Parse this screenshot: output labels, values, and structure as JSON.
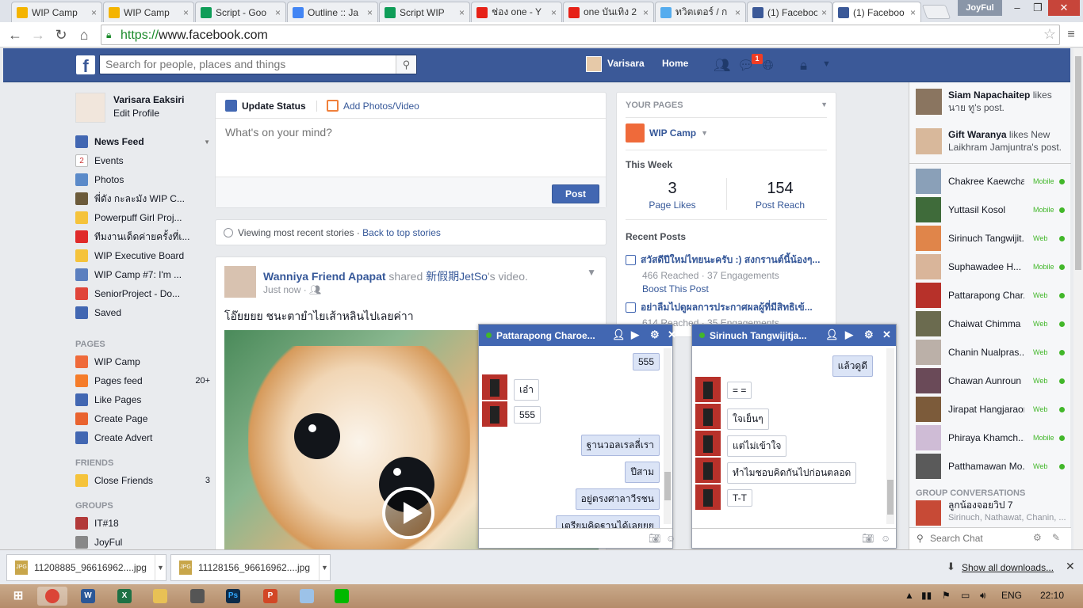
{
  "browser": {
    "tabs": [
      {
        "title": "WIP Camp",
        "icon": "drive-icon",
        "color": "#f4b400"
      },
      {
        "title": "WIP Camp",
        "icon": "drive-icon",
        "color": "#f4b400"
      },
      {
        "title": "Script - Goo",
        "icon": "sheets-icon",
        "color": "#0f9d58"
      },
      {
        "title": "Outline :: Ja",
        "icon": "docs-icon",
        "color": "#4285f4"
      },
      {
        "title": "Script WIP",
        "icon": "sheets-icon",
        "color": "#0f9d58"
      },
      {
        "title": "ช่อง one - Y",
        "icon": "youtube-icon",
        "color": "#e62117"
      },
      {
        "title": "one บันเทิง 2",
        "icon": "youtube-icon",
        "color": "#e62117"
      },
      {
        "title": "ทวิตเตอร์ / ก",
        "icon": "twitter-icon",
        "color": "#55acee"
      },
      {
        "title": "(1) Faceboo",
        "icon": "facebook-icon",
        "color": "#3b5998"
      },
      {
        "title": "(1) Faceboo",
        "icon": "facebook-icon",
        "color": "#3b5998"
      }
    ],
    "user": "JoyFul",
    "url_scheme": "https://",
    "url_host": "www.facebook.com"
  },
  "fb": {
    "logo": "f",
    "search_placeholder": "Search for people, places and things",
    "user_name": "Varisara",
    "home": "Home",
    "notif_count": "1"
  },
  "left": {
    "name": "Varisara Eaksiri",
    "edit": "Edit Profile",
    "favorites": [
      {
        "label": "News Feed",
        "bold": true,
        "icon": "news-feed-icon",
        "color": "#4267b2"
      },
      {
        "label": "Events",
        "icon": "calendar-icon",
        "color": "#ffffff",
        "badge": "2"
      },
      {
        "label": "Photos",
        "icon": "photos-icon",
        "color": "#5b8ac9"
      },
      {
        "label": "พี่ดัง กะละมัง WIP C...",
        "icon": "star-group-icon",
        "color": "#6b5a3a"
      },
      {
        "label": "Powerpuff Girl Proj...",
        "icon": "lightbulb-icon",
        "color": "#f5c33b"
      },
      {
        "label": "ทีมงานเด็ดค่ายครั้งที่เ...",
        "icon": "cup-icon",
        "color": "#e02a2a"
      },
      {
        "label": "WIP Executive Board",
        "icon": "lightbulb-icon",
        "color": "#f5c33b"
      },
      {
        "label": "WIP Camp #7: I'm ...",
        "icon": "shield-icon",
        "color": "#5b7fbf"
      },
      {
        "label": "SeniorProject - Do...",
        "icon": "gift-icon",
        "color": "#e0453a"
      },
      {
        "label": "Saved",
        "icon": "bookmark-icon",
        "color": "#4267b2"
      }
    ],
    "pages_title": "PAGES",
    "pages": [
      {
        "label": "WIP Camp",
        "icon": "wip-page-icon",
        "color": "#ef6a3a",
        "count": ""
      },
      {
        "label": "Pages feed",
        "icon": "flag-icon",
        "color": "#f57c2a",
        "count": "20+"
      },
      {
        "label": "Like Pages",
        "icon": "like-icon",
        "color": "#4267b2",
        "count": ""
      },
      {
        "label": "Create Page",
        "icon": "plus-icon",
        "color": "#e9632f",
        "count": ""
      },
      {
        "label": "Create Advert",
        "icon": "chart-icon",
        "color": "#4267b2",
        "count": ""
      }
    ],
    "friends_title": "FRIENDS",
    "friends": [
      {
        "label": "Close Friends",
        "icon": "star-icon",
        "color": "#f5c33b",
        "count": "3"
      }
    ],
    "groups_title": "GROUPS",
    "groups": [
      {
        "label": "IT#18",
        "icon": "glass-icon",
        "color": "#b23a3a"
      },
      {
        "label": "JoyFul",
        "icon": "skull-icon",
        "color": "#888888"
      }
    ]
  },
  "composer": {
    "update_status": "Update Status",
    "add_photos": "Add Photos/Video",
    "placeholder": "What's on your mind?",
    "post": "Post"
  },
  "recent": {
    "text": "Viewing most recent stories · ",
    "link": "Back to top stories"
  },
  "post": {
    "author": "Wanniya Friend Apapat",
    "action": " shared ",
    "source": "新假期JetSo",
    "suffix": "'s video.",
    "time": "Just now · ",
    "text": "โอ๊ยยยย ชนะตายำไยเส้าหลินไปเลยค่าา"
  },
  "pages_box": {
    "title": "YOUR PAGES",
    "page_name": "WIP Camp",
    "this_week": "This Week",
    "likes_value": "3",
    "likes_label": "Page Likes",
    "reach_value": "154",
    "reach_label": "Post Reach",
    "recent_title": "Recent Posts",
    "posts": [
      {
        "title": "สวัสดีปีใหม่ไทยนะครับ :) สงกรานต์นี้น้องๆ...",
        "meta": "466 Reached · 37 Engagements",
        "boost": "Boost This Post"
      },
      {
        "title": "อย่าลืมไปดูผลการประกาศผลผู้ที่มีสิทธิเข้...",
        "meta": "614 Reached · 35 Engagements"
      }
    ]
  },
  "chats": [
    {
      "name": "Pattarapong Charoe...",
      "messages": [
        {
          "text": "555",
          "me": true
        },
        {
          "text": "เอ๋า",
          "me": false
        },
        {
          "text": "555",
          "me": false
        },
        {
          "text": "ฐานวอลเรลลี่เรา",
          "me": true
        },
        {
          "text": "ปีสาม",
          "me": true
        },
        {
          "text": "อยู่ตรงศาลาวีรชน",
          "me": true
        },
        {
          "text": "เตรียมคิดฐานได้เลยยย",
          "me": true
        }
      ]
    },
    {
      "name": "Sirinuch Tangwijitja...",
      "messages": [
        {
          "text": "แล้วดูดี",
          "me": true
        },
        {
          "text": "= =",
          "me": false
        },
        {
          "text": "ใจเย็นๆ",
          "me": false
        },
        {
          "text": "แต่ไม่เข้าใจ",
          "me": false
        },
        {
          "text": "ทำไมชอบคิดกันไปก่อนตลอด",
          "me": false
        },
        {
          "text": "T-T",
          "me": false
        }
      ]
    }
  ],
  "ticker": [
    {
      "name": "Siam Napachaitep",
      "text": " likes นาย ทู's post."
    },
    {
      "name": "Gift Waranya",
      "text": " likes New Laikhram Jamjuntra's post."
    }
  ],
  "contacts": [
    {
      "name": "Chakree Kaewchai",
      "status": "Mobile"
    },
    {
      "name": "Yuttasil Kosol",
      "status": "Mobile"
    },
    {
      "name": "Sirinuch Tangwijit...",
      "status": "Web"
    },
    {
      "name": "Suphawadee H...",
      "status": "Mobile"
    },
    {
      "name": "Pattarapong Char...",
      "status": "Web"
    },
    {
      "name": "Chaiwat Chimma",
      "status": "Web"
    },
    {
      "name": "Chanin Nualpras...",
      "status": "Web"
    },
    {
      "name": "Chawan Aunroun",
      "status": "Web"
    },
    {
      "name": "Jirapat Hangjaraon",
      "status": "Web"
    },
    {
      "name": "Phiraya Khamch...",
      "status": "Mobile"
    },
    {
      "name": "Patthamawan Mo...",
      "status": "Web"
    }
  ],
  "group_conversations": {
    "title": "GROUP CONVERSATIONS",
    "name": "ลูกน้องจอยวิป 7",
    "members": "Sirinuch, Nathawat, Chanin, ..."
  },
  "search_chat": "Search Chat",
  "downloads": {
    "files": [
      "11208885_96616962....jpg",
      "11128156_96616962....jpg"
    ],
    "show_all": "Show all downloads..."
  },
  "taskbar": {
    "lang": "ENG",
    "time": "22:10"
  }
}
